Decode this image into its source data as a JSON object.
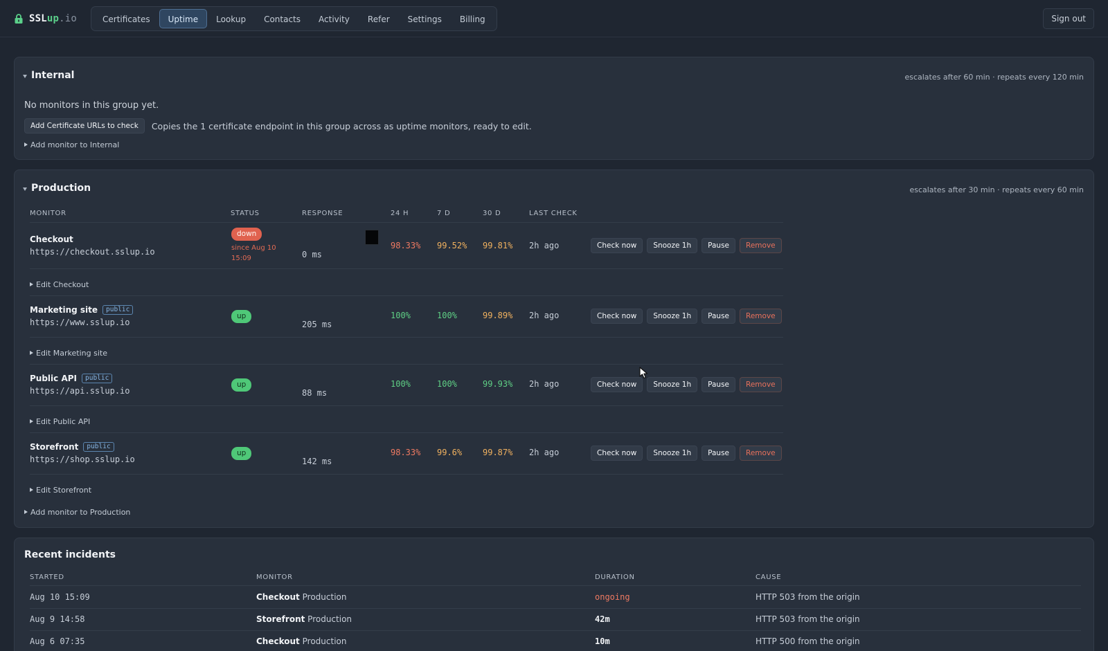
{
  "app": {
    "brand_prefix": "SSL",
    "brand_accent": "up",
    "brand_tld": ".io",
    "nav": [
      "Certificates",
      "Uptime",
      "Lookup",
      "Contacts",
      "Activity",
      "Refer",
      "Settings",
      "Billing"
    ],
    "active_nav": "Uptime",
    "sign_out": "Sign out"
  },
  "internal": {
    "title": "Internal",
    "escalation": "escalates after 60 min · repeats every 120 min",
    "empty": "No monitors in this group yet.",
    "copy_button": "Add Certificate URLs to check",
    "copy_text": "Copies the 1 certificate endpoint in this group across as uptime monitors, ready to edit.",
    "add_monitor": "Add monitor to Internal"
  },
  "production": {
    "title": "Production",
    "escalation": "escalates after 30 min · repeats every 60 min",
    "columns": {
      "monitor": "Monitor",
      "status": "Status",
      "response": "Response",
      "h24": "24 h",
      "d7": "7 d",
      "d30": "30 d",
      "last": "Last check"
    },
    "monitors": [
      {
        "name": "Checkout",
        "badge": "",
        "url": "https://checkout.sslup.io",
        "status": "down",
        "since_1": "since Aug 10",
        "since_2": "15:09",
        "response": "0 ms",
        "h24": "98.33%",
        "d7": "99.52%",
        "d30": "99.81%",
        "last": "2h ago",
        "edit": "Edit Checkout"
      },
      {
        "name": "Marketing site",
        "badge": "public",
        "url": "https://www.sslup.io",
        "status": "up",
        "response": "205 ms",
        "h24": "100%",
        "d7": "100%",
        "d30": "99.89%",
        "last": "2h ago",
        "edit": "Edit Marketing site"
      },
      {
        "name": "Public API",
        "badge": "public",
        "url": "https://api.sslup.io",
        "status": "up",
        "response": "88 ms",
        "h24": "100%",
        "d7": "100%",
        "d30": "99.93%",
        "last": "2h ago",
        "edit": "Edit Public API"
      },
      {
        "name": "Storefront",
        "badge": "public",
        "url": "https://shop.sslup.io",
        "status": "up",
        "response": "142 ms",
        "h24": "98.33%",
        "d7": "99.6%",
        "d30": "99.87%",
        "last": "2h ago",
        "edit": "Edit Storefront"
      }
    ],
    "actions": {
      "check": "Check now",
      "snooze": "Snooze 1h",
      "pause": "Pause",
      "remove": "Remove"
    },
    "add_monitor": "Add monitor to Production"
  },
  "incidents": {
    "title": "Recent incidents",
    "columns": {
      "started": "Started",
      "monitor": "Monitor",
      "duration": "Duration",
      "cause": "Cause"
    },
    "rows": [
      {
        "started": "Aug 10 15:09",
        "monitor": "Checkout",
        "group": "Production",
        "duration": "ongoing",
        "cause": "HTTP 503 from the origin"
      },
      {
        "started": "Aug 9 14:58",
        "monitor": "Storefront",
        "group": "Production",
        "duration": "42m",
        "cause": "HTTP 503 from the origin"
      },
      {
        "started": "Aug 6 07:35",
        "monitor": "Checkout",
        "group": "Production",
        "duration": "10m",
        "cause": "HTTP 500 from the origin"
      }
    ]
  },
  "colors": {
    "background": "#1f2631",
    "panel": "#28303c",
    "accent": "#5bd08a",
    "down": "#e0624f",
    "up": "#4fc878",
    "warn": "#f0b15f"
  }
}
